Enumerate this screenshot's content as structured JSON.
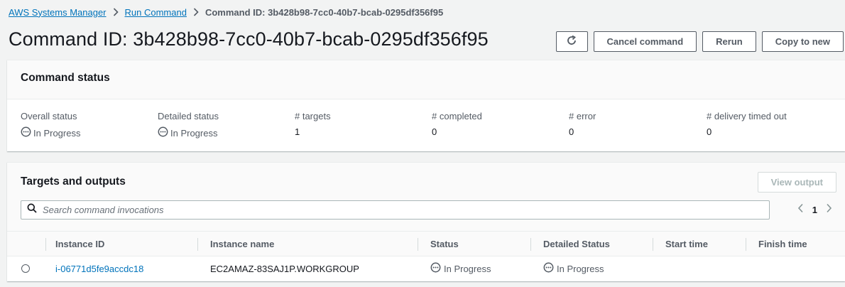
{
  "breadcrumb": {
    "items": [
      "AWS Systems Manager",
      "Run Command"
    ],
    "current": "Command ID: 3b428b98-7cc0-40b7-bcab-0295df356f95"
  },
  "page": {
    "title": "Command ID: 3b428b98-7cc0-40b7-bcab-0295df356f95"
  },
  "actions": {
    "refresh_icon": "refresh-icon",
    "cancel": "Cancel command",
    "rerun": "Rerun",
    "copy": "Copy to new"
  },
  "command_status": {
    "title": "Command status",
    "overall_label": "Overall status",
    "overall_value": "In Progress",
    "detailed_label": "Detailed status",
    "detailed_value": "In Progress",
    "targets_label": "# targets",
    "targets_value": "1",
    "completed_label": "# completed",
    "completed_value": "0",
    "error_label": "# error",
    "error_value": "0",
    "timed_out_label": "# delivery timed out",
    "timed_out_value": "0"
  },
  "targets": {
    "title": "Targets and outputs",
    "view_output": "View output",
    "search_placeholder": "Search command invocations",
    "page_number": "1",
    "columns": [
      "Instance ID",
      "Instance name",
      "Status",
      "Detailed Status",
      "Start time",
      "Finish time"
    ],
    "rows": [
      {
        "instance_id": "i-06771d5fe9accdc18",
        "instance_name": "EC2AMAZ-83SAJ1P.WORKGROUP",
        "status": "In Progress",
        "detailed_status": "In Progress",
        "start_time": "",
        "finish_time": ""
      }
    ]
  },
  "colors": {
    "link": "#0073bb",
    "text": "#16191f",
    "secondary": "#545b64",
    "background": "#f2f3f3",
    "disabled": "#aab7b8"
  }
}
